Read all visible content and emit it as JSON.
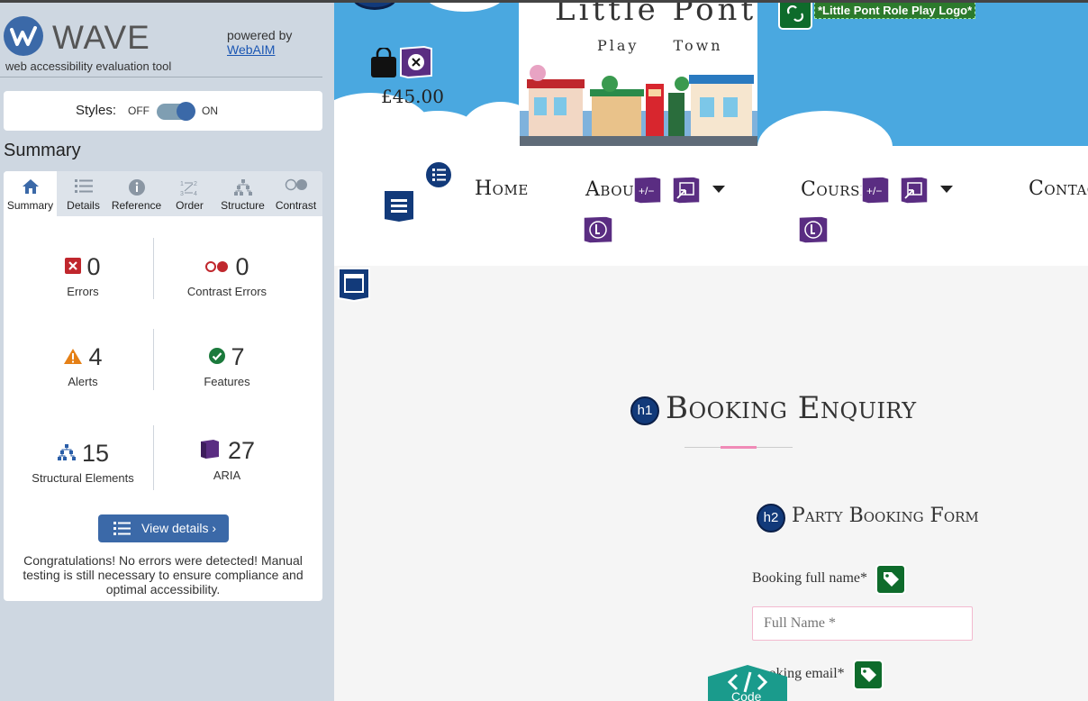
{
  "wave": {
    "logo_text": "WAVE",
    "tagline": "web accessibility evaluation tool",
    "powered_by": "powered by",
    "webaim_link": "WebAIM",
    "styles": {
      "label": "Styles:",
      "off": "OFF",
      "on": "ON",
      "state": "on"
    },
    "summary_heading": "Summary",
    "tabs": [
      {
        "label": "Summary",
        "icon": "home-icon",
        "active": true
      },
      {
        "label": "Details",
        "icon": "list-icon",
        "active": false
      },
      {
        "label": "Reference",
        "icon": "info-icon",
        "active": false
      },
      {
        "label": "Order",
        "icon": "order-icon",
        "active": false
      },
      {
        "label": "Structure",
        "icon": "structure-icon",
        "active": false
      },
      {
        "label": "Contrast",
        "icon": "contrast-icon",
        "active": false
      }
    ],
    "stats": {
      "errors": {
        "count": "0",
        "label": "Errors"
      },
      "contrast_errors": {
        "count": "0",
        "label": "Contrast Errors"
      },
      "alerts": {
        "count": "4",
        "label": "Alerts"
      },
      "features": {
        "count": "7",
        "label": "Features"
      },
      "structural": {
        "count": "15",
        "label": "Structural Elements"
      },
      "aria": {
        "count": "27",
        "label": "ARIA"
      }
    },
    "view_details": "View details ›",
    "congrats": "Congratulations! No errors were detected! Manual testing is still necessary to ensure compliance and optimal accessibility."
  },
  "site": {
    "logo_title": "Little Pont",
    "logo_subtitle": "Play Town",
    "cart_price": "£45.00",
    "logo_alt": "*Little Pont Role Play Logo*",
    "nav": {
      "home": "Home",
      "about": "About",
      "courses": "Courses",
      "contact": "Contact"
    },
    "h1_badge": "h1",
    "h1": "Booking Enquiry",
    "h2_badge": "h2",
    "h2": "Party Booking Form",
    "name_label": "Booking full name*",
    "name_placeholder": "Full Name *",
    "email_label": "Booking email*",
    "code_button": "Code"
  },
  "colors": {
    "wave_blue": "#3b69a8",
    "sidebar_bg": "#ced7e1",
    "aria_purple": "#5a2d82",
    "feature_green": "#0e6b2b",
    "hero_sky": "#4aa8e0"
  }
}
